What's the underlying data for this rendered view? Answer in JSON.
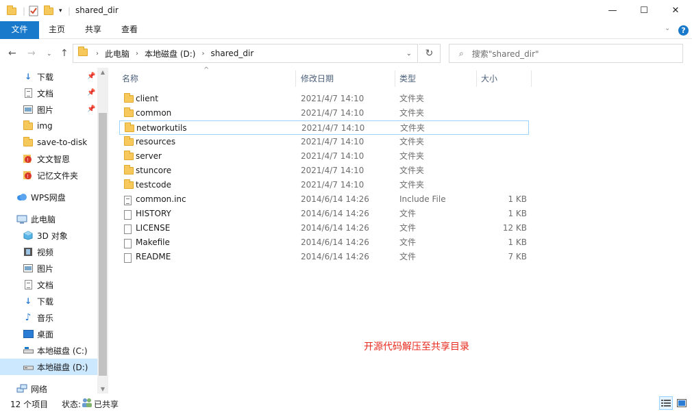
{
  "window": {
    "title": "shared_dir",
    "minimize": "—",
    "maximize": "☐",
    "close": "✕"
  },
  "ribbon": {
    "tabs": [
      "文件",
      "主页",
      "共享",
      "查看"
    ],
    "help": "?"
  },
  "address": {
    "segments": [
      "此电脑",
      "本地磁盘 (D:)",
      "shared_dir"
    ],
    "search_placeholder": "搜索\"shared_dir\""
  },
  "sidebar": {
    "quick": [
      {
        "label": "下载",
        "icon": "download-arrow-icon",
        "pinned": true
      },
      {
        "label": "文档",
        "icon": "document-icon",
        "pinned": true
      },
      {
        "label": "图片",
        "icon": "picture-icon",
        "pinned": true
      },
      {
        "label": "img",
        "icon": "folder-icon"
      },
      {
        "label": "save-to-disk",
        "icon": "folder-icon"
      },
      {
        "label": "文文智恩",
        "icon": "red-badge-icon"
      },
      {
        "label": "记忆文件夹",
        "icon": "red-badge-icon"
      }
    ],
    "wps": "WPS网盘",
    "pc": "此电脑",
    "pc_items": [
      {
        "label": "3D 对象",
        "icon": "cube-icon"
      },
      {
        "label": "视频",
        "icon": "film-icon"
      },
      {
        "label": "图片",
        "icon": "picture-icon"
      },
      {
        "label": "文档",
        "icon": "document-icon"
      },
      {
        "label": "下载",
        "icon": "download-arrow-icon"
      },
      {
        "label": "音乐",
        "icon": "music-note-icon"
      },
      {
        "label": "桌面",
        "icon": "desktop-icon"
      },
      {
        "label": "本地磁盘 (C:)",
        "icon": "drive-icon"
      },
      {
        "label": "本地磁盘 (D:)",
        "icon": "drive-icon"
      }
    ],
    "network": "网络"
  },
  "columns": {
    "name": "名称",
    "date": "修改日期",
    "type": "类型",
    "size": "大小"
  },
  "files": [
    {
      "name": "client",
      "date": "2021/4/7 14:10",
      "type": "文件夹",
      "size": "",
      "kind": "folder"
    },
    {
      "name": "common",
      "date": "2021/4/7 14:10",
      "type": "文件夹",
      "size": "",
      "kind": "folder"
    },
    {
      "name": "networkutils",
      "date": "2021/4/7 14:10",
      "type": "文件夹",
      "size": "",
      "kind": "folder"
    },
    {
      "name": "resources",
      "date": "2021/4/7 14:10",
      "type": "文件夹",
      "size": "",
      "kind": "folder"
    },
    {
      "name": "server",
      "date": "2021/4/7 14:10",
      "type": "文件夹",
      "size": "",
      "kind": "folder"
    },
    {
      "name": "stuncore",
      "date": "2021/4/7 14:10",
      "type": "文件夹",
      "size": "",
      "kind": "folder"
    },
    {
      "name": "testcode",
      "date": "2021/4/7 14:10",
      "type": "文件夹",
      "size": "",
      "kind": "folder"
    },
    {
      "name": "common.inc",
      "date": "2014/6/14 14:26",
      "type": "Include File",
      "size": "1 KB",
      "kind": "inc"
    },
    {
      "name": "HISTORY",
      "date": "2014/6/14 14:26",
      "type": "文件",
      "size": "1 KB",
      "kind": "file"
    },
    {
      "name": "LICENSE",
      "date": "2014/6/14 14:26",
      "type": "文件",
      "size": "12 KB",
      "kind": "file"
    },
    {
      "name": "Makefile",
      "date": "2014/6/14 14:26",
      "type": "文件",
      "size": "1 KB",
      "kind": "file"
    },
    {
      "name": "README",
      "date": "2014/6/14 14:26",
      "type": "文件",
      "size": "7 KB",
      "kind": "file"
    }
  ],
  "annotation": "开源代码解压至共享目录",
  "status": {
    "count": "12 个项目",
    "state_label": "状态:",
    "state_value": "已共享"
  }
}
